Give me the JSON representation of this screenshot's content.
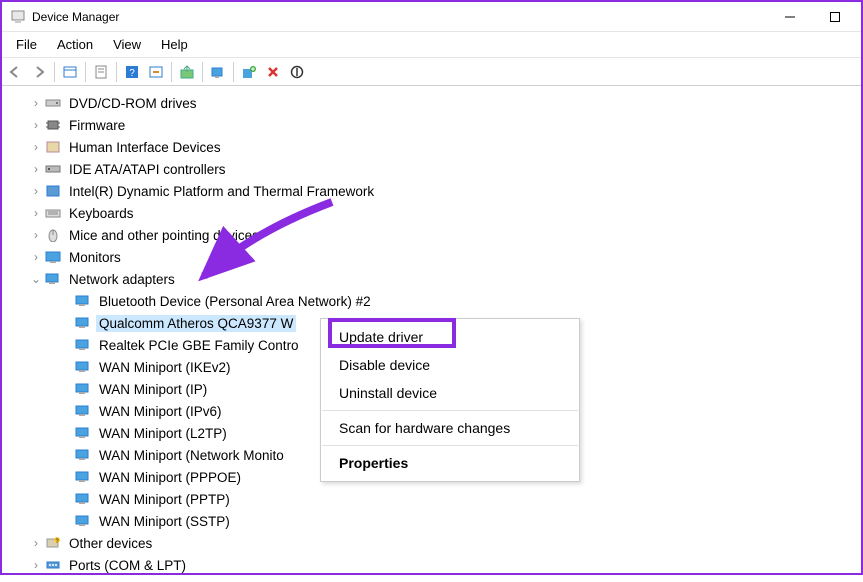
{
  "window": {
    "title": "Device Manager"
  },
  "menu": {
    "file": "File",
    "action": "Action",
    "view": "View",
    "help": "Help"
  },
  "toolbar_icons": [
    "back",
    "forward",
    "up",
    "properties",
    "help",
    "refresh",
    "add-hw",
    "scan-hw",
    "update",
    "disable",
    "uninstall"
  ],
  "tree": {
    "top": [
      {
        "label": "DVD/CD-ROM drives",
        "icon": "drive"
      },
      {
        "label": "Firmware",
        "icon": "chip"
      },
      {
        "label": "Human Interface Devices",
        "icon": "hid"
      },
      {
        "label": "IDE ATA/ATAPI controllers",
        "icon": "ide"
      },
      {
        "label": "Intel(R) Dynamic Platform and Thermal Framework",
        "icon": "board"
      },
      {
        "label": "Keyboards",
        "icon": "kbd"
      },
      {
        "label": "Mice and other pointing devices",
        "icon": "mouse"
      },
      {
        "label": "Monitors",
        "icon": "monitor"
      }
    ],
    "network_label": "Network adapters",
    "network_children": [
      "Bluetooth Device (Personal Area Network) #2",
      "Qualcomm Atheros QCA9377 W",
      "Realtek PCIe GBE Family Contro",
      "WAN Miniport (IKEv2)",
      "WAN Miniport (IP)",
      "WAN Miniport (IPv6)",
      "WAN Miniport (L2TP)",
      "WAN Miniport (Network Monito",
      "WAN Miniport (PPPOE)",
      "WAN Miniport (PPTP)",
      "WAN Miniport (SSTP)"
    ],
    "bottom": [
      {
        "label": "Other devices",
        "icon": "other"
      },
      {
        "label": "Ports (COM & LPT)",
        "icon": "port"
      }
    ]
  },
  "context_menu": {
    "update": "Update driver",
    "disable": "Disable device",
    "uninstall": "Uninstall device",
    "scan": "Scan for hardware changes",
    "properties": "Properties"
  }
}
